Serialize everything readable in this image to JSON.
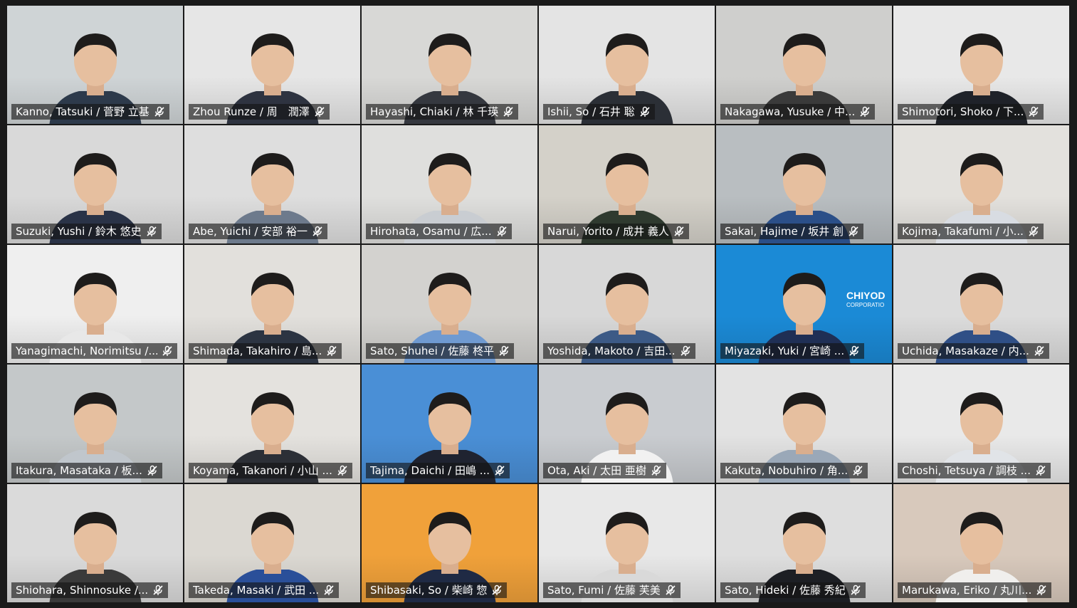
{
  "meeting": {
    "brand_text": "CHIYOD",
    "brand_subtext": "CORPORATIO",
    "participants": [
      {
        "name": "Kanno, Tatsuki / 菅野 立基",
        "muted_icon": "mic-muted-icon",
        "bg": "#cfd4d6",
        "shirt": "#2d3a4b"
      },
      {
        "name": "Zhou Runze / 周　潤澤",
        "muted_icon": "mic-muted-icon",
        "bg": "#e6e6e6",
        "shirt": "#2e3340"
      },
      {
        "name": "Hayashi, Chiaki / 林 千瑛",
        "muted_icon": "mic-muted-icon",
        "bg": "#d8d8d6",
        "shirt": "#35383f"
      },
      {
        "name": "Ishii, So / 石井 聡",
        "muted_icon": "mic-muted-icon",
        "bg": "#e4e4e4",
        "shirt": "#2b2f36"
      },
      {
        "name": "Nakagawa, Yusuke / 中...",
        "muted_icon": "mic-muted-icon",
        "bg": "#cfcfcd",
        "shirt": "#3a3a3a"
      },
      {
        "name": "Shimotori, Shoko / 下...",
        "muted_icon": "mic-muted-icon",
        "bg": "#e8e8e8",
        "shirt": "#1f2229"
      },
      {
        "name": "Suzuki, Yushi / 鈴木 悠史",
        "muted_icon": "mic-muted-icon",
        "bg": "#d9d9d9",
        "shirt": "#2a3347"
      },
      {
        "name": "Abe, Yuichi / 安部 裕一",
        "muted_icon": "mic-muted-icon",
        "bg": "#dedede",
        "shirt": "#6d7a8c"
      },
      {
        "name": "Hirohata, Osamu / 広...",
        "muted_icon": "mic-muted-icon",
        "bg": "#dfdfdd",
        "shirt": "#c9cdd2"
      },
      {
        "name": "Narui, Yorito / 成井 義人",
        "muted_icon": "mic-muted-icon",
        "bg": "#d4d1c9",
        "shirt": "#2f3a2f"
      },
      {
        "name": "Sakai, Hajime / 坂井 創",
        "muted_icon": "mic-muted-icon",
        "bg": "#b9bec1",
        "shirt": "#2b4f88"
      },
      {
        "name": "Kojima, Takafumi / 小...",
        "muted_icon": "mic-muted-icon",
        "bg": "#e3e1dd",
        "shirt": "#d8dce2"
      },
      {
        "name": "Yanagimachi, Norimitsu /...",
        "muted_icon": "mic-muted-icon",
        "bg": "#efefef",
        "shirt": "#e8e8e8"
      },
      {
        "name": "Shimada, Takahiro / 島...",
        "muted_icon": "mic-muted-icon",
        "bg": "#e2e0dc",
        "shirt": "#2c3442"
      },
      {
        "name": "Sato, Shuhei / 佐藤 柊平",
        "muted_icon": "mic-muted-icon",
        "bg": "#d3d2cf",
        "shirt": "#6f9ad1"
      },
      {
        "name": "Yoshida, Makoto / 吉田...",
        "muted_icon": "mic-muted-icon",
        "bg": "#d8d8d8",
        "shirt": "#3c5a86"
      },
      {
        "name": "Miyazaki, Yuki / 宮崎 ...",
        "muted_icon": "mic-muted-icon",
        "bg": "#1b8ad6",
        "shirt": "#1f2f55",
        "brand": true
      },
      {
        "name": "Uchida, Masakaze / 内...",
        "muted_icon": "mic-muted-icon",
        "bg": "#dcdcdc",
        "shirt": "#2f4f86"
      },
      {
        "name": "Itakura, Masataka / 板...",
        "muted_icon": "mic-muted-icon",
        "bg": "#c4c8c9",
        "shirt": "#c0c6cc"
      },
      {
        "name": "Koyama, Takanori / 小山 ...",
        "muted_icon": "mic-muted-icon",
        "bg": "#e4e2de",
        "shirt": "#2c2f36"
      },
      {
        "name": "Tajima, Daichi / 田嶋 ...",
        "muted_icon": "mic-muted-icon",
        "bg": "#4a8fd6",
        "shirt": "#1f2330"
      },
      {
        "name": "Ota, Aki / 太田 亜樹",
        "muted_icon": "mic-muted-icon",
        "bg": "#c9ccd0",
        "shirt": "#f1f1f1"
      },
      {
        "name": "Kakuta, Nobuhiro / 角...",
        "muted_icon": "mic-muted-icon",
        "bg": "#e3e3e3",
        "shirt": "#9aa8b8"
      },
      {
        "name": "Choshi, Tetsuya / 調枝 ...",
        "muted_icon": "mic-muted-icon",
        "bg": "#e9e9e9",
        "shirt": "#e1e4e8"
      },
      {
        "name": "Shiohara, Shinnosuke /...",
        "muted_icon": "mic-muted-icon",
        "bg": "#dadada",
        "shirt": "#3a3a3a"
      },
      {
        "name": "Takeda, Masaki / 武田 ...",
        "muted_icon": "mic-muted-icon",
        "bg": "#dbd8d2",
        "shirt": "#2a4f99"
      },
      {
        "name": "Shibasaki, So / 柴崎 惣",
        "muted_icon": "mic-muted-icon",
        "bg": "#f0a13a",
        "shirt": "#1f2a44"
      },
      {
        "name": "Sato, Fumi / 佐藤 芙美",
        "muted_icon": "mic-muted-icon",
        "bg": "#e8e8e8",
        "shirt": "#d9d9d9"
      },
      {
        "name": "Sato, Hideki / 佐藤 秀紀",
        "muted_icon": "mic-muted-icon",
        "bg": "#dedede",
        "shirt": "#1d1f24"
      },
      {
        "name": "Marukawa, Eriko / 丸川...",
        "muted_icon": "mic-muted-icon",
        "bg": "#d8c9bc",
        "shirt": "#f0efed"
      }
    ]
  }
}
